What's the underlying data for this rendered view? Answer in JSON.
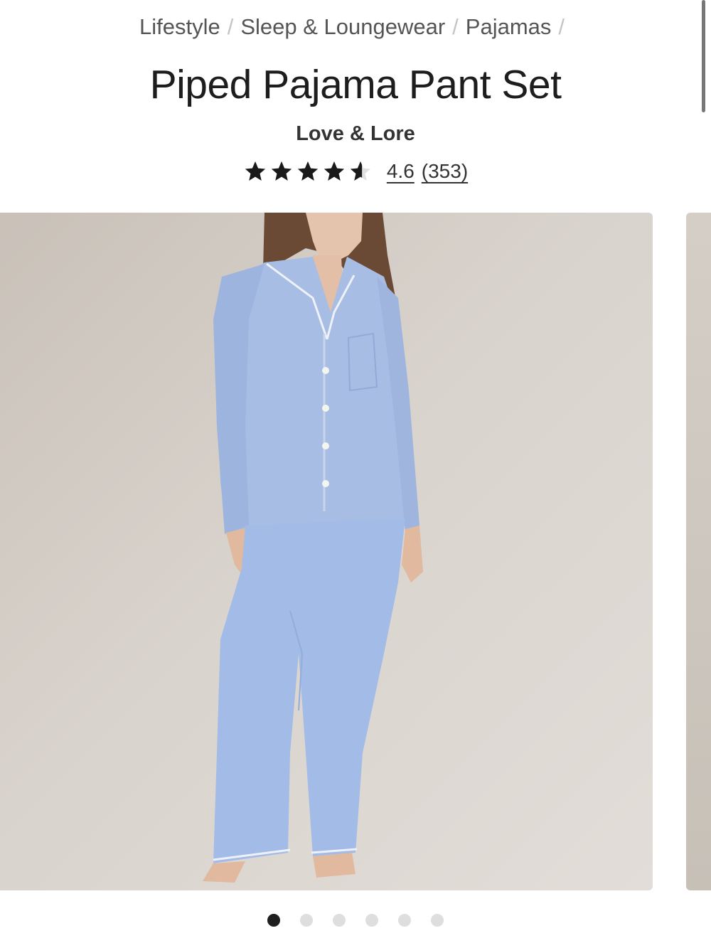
{
  "breadcrumb": {
    "items": [
      "Lifestyle",
      "Sleep & Loungewear",
      "Pajamas"
    ],
    "separator": "/"
  },
  "product": {
    "title": "Piped Pajama Pant Set",
    "brand": "Love & Lore",
    "rating_value": "4.6",
    "review_count": "(353)",
    "stars": 4.6
  },
  "gallery": {
    "image_count": 6,
    "active_index": 0
  },
  "colors": {
    "star": "#1a1a1a",
    "dot_active": "#1f1f1f",
    "dot_inactive": "#dedede",
    "pajama": "#a9bfe6"
  }
}
